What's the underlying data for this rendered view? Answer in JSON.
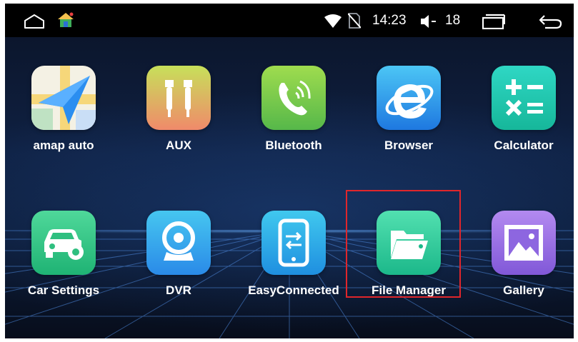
{
  "statusbar": {
    "time": "14:23",
    "volume_level": "18",
    "icons": [
      "home-icon",
      "launcher-home-icon",
      "wifi-icon",
      "no-sim-icon",
      "volume-icon",
      "recent-apps-icon",
      "back-icon"
    ]
  },
  "apps": [
    {
      "label": "amap auto",
      "icon": "amap-auto-icon"
    },
    {
      "label": "AUX",
      "icon": "aux-icon"
    },
    {
      "label": "Bluetooth",
      "icon": "bluetooth-icon"
    },
    {
      "label": "Browser",
      "icon": "browser-icon"
    },
    {
      "label": "Calculator",
      "icon": "calculator-icon"
    },
    {
      "label": "Car Settings",
      "icon": "car-settings-icon"
    },
    {
      "label": "DVR",
      "icon": "dvr-icon"
    },
    {
      "label": "EasyConnected",
      "icon": "easyconnected-icon"
    },
    {
      "label": "File Manager",
      "icon": "file-manager-icon"
    },
    {
      "label": "Gallery",
      "icon": "gallery-icon"
    }
  ],
  "colors": {
    "highlight_border": "#e0262b",
    "statusbar_bg": "#000000"
  }
}
